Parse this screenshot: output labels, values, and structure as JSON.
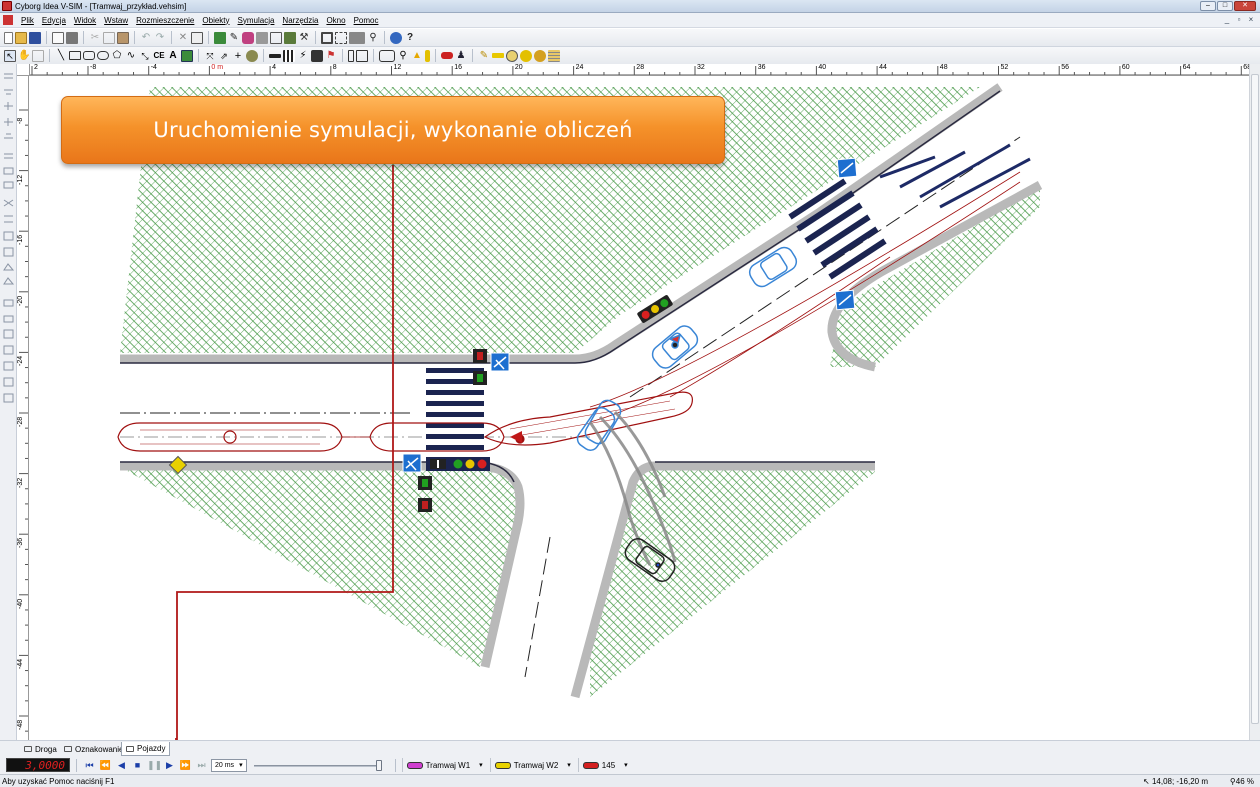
{
  "window": {
    "title": "Cyborg Idea V-SIM - [Tramwaj_przykład.vehsim]"
  },
  "menu": {
    "items": [
      "Plik",
      "Edycja",
      "Widok",
      "Wstaw",
      "Rozmieszczenie",
      "Obiekty",
      "Symulacja",
      "Narzędzia",
      "Okno",
      "Pomoc"
    ]
  },
  "rulers": {
    "h_ticks": [
      "2",
      "-8",
      "-4",
      "0 m",
      "4",
      "8",
      "12",
      "16",
      "20",
      "24",
      "28",
      "32",
      "36",
      "40",
      "44",
      "48",
      "52",
      "56",
      "60",
      "64",
      "68"
    ],
    "v_ticks": [
      "-8",
      "-12",
      "-16",
      "-20",
      "-24",
      "-28",
      "-32",
      "-36",
      "-40",
      "-44",
      "-48"
    ]
  },
  "callout": {
    "text": "Uruchomienie symulacji, wykonanie obliczeń"
  },
  "tabs": [
    "Droga",
    "Oznakowanie",
    "Pojazdy"
  ],
  "active_tab": "Pojazdy",
  "simulation": {
    "time": "3,0000",
    "step": "20 ms",
    "vehicles": [
      {
        "label": "Tramwaj W1",
        "color": "#d03fd0"
      },
      {
        "label": "Tramwaj W2",
        "color": "#e8d200"
      },
      {
        "label": "145",
        "color": "#d32020"
      }
    ]
  },
  "status": {
    "hint": "Aby uzyskać Pomoc naciśnij F1",
    "coords": "14,08; -16,20 m",
    "zoom": "46 %"
  },
  "colors": {
    "callout_orange": "#f5922a",
    "road_gray": "#b9b9b9",
    "grass_green": "#2e8b2e",
    "tram_red": "#a01010",
    "car_blue": "#3a86d6",
    "arrow_red": "#b01818"
  }
}
